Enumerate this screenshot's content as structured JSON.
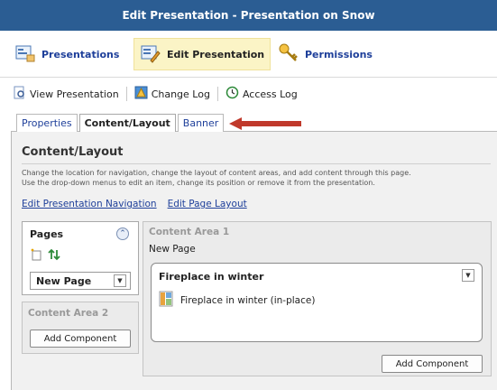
{
  "window": {
    "title": "Edit Presentation - Presentation on Snow"
  },
  "nav": {
    "presentations": "Presentations",
    "edit_presentation": "Edit Presentation",
    "permissions": "Permissions"
  },
  "toolbar": {
    "view_presentation": "View Presentation",
    "change_log": "Change Log",
    "access_log": "Access Log"
  },
  "tabs": [
    {
      "label": "Properties"
    },
    {
      "label": "Content/Layout"
    },
    {
      "label": "Banner"
    }
  ],
  "content": {
    "heading": "Content/Layout",
    "description_line1": "Change the location for navigation, change the layout of content areas, and add content through this page.",
    "description_line2": "Use the drop-down menus to edit an item, change its position or remove it from the presentation.",
    "link_nav": "Edit Presentation Navigation",
    "link_layout": "Edit Page Layout"
  },
  "pages": {
    "title": "Pages",
    "selected_page": "New Page"
  },
  "content_area_2": {
    "title": "Content Area 2",
    "add_button": "Add Component"
  },
  "content_area_1": {
    "title": "Content Area 1",
    "page_name": "New Page",
    "component_title": "Fireplace in winter",
    "component_item": "Fireplace in winter (in-place)",
    "add_button": "Add Component"
  },
  "colors": {
    "titlebar": "#2b5d93",
    "link": "#1e3f9a",
    "active_nav_bg": "#fbf4c6",
    "annotation_arrow": "#c0392b"
  }
}
